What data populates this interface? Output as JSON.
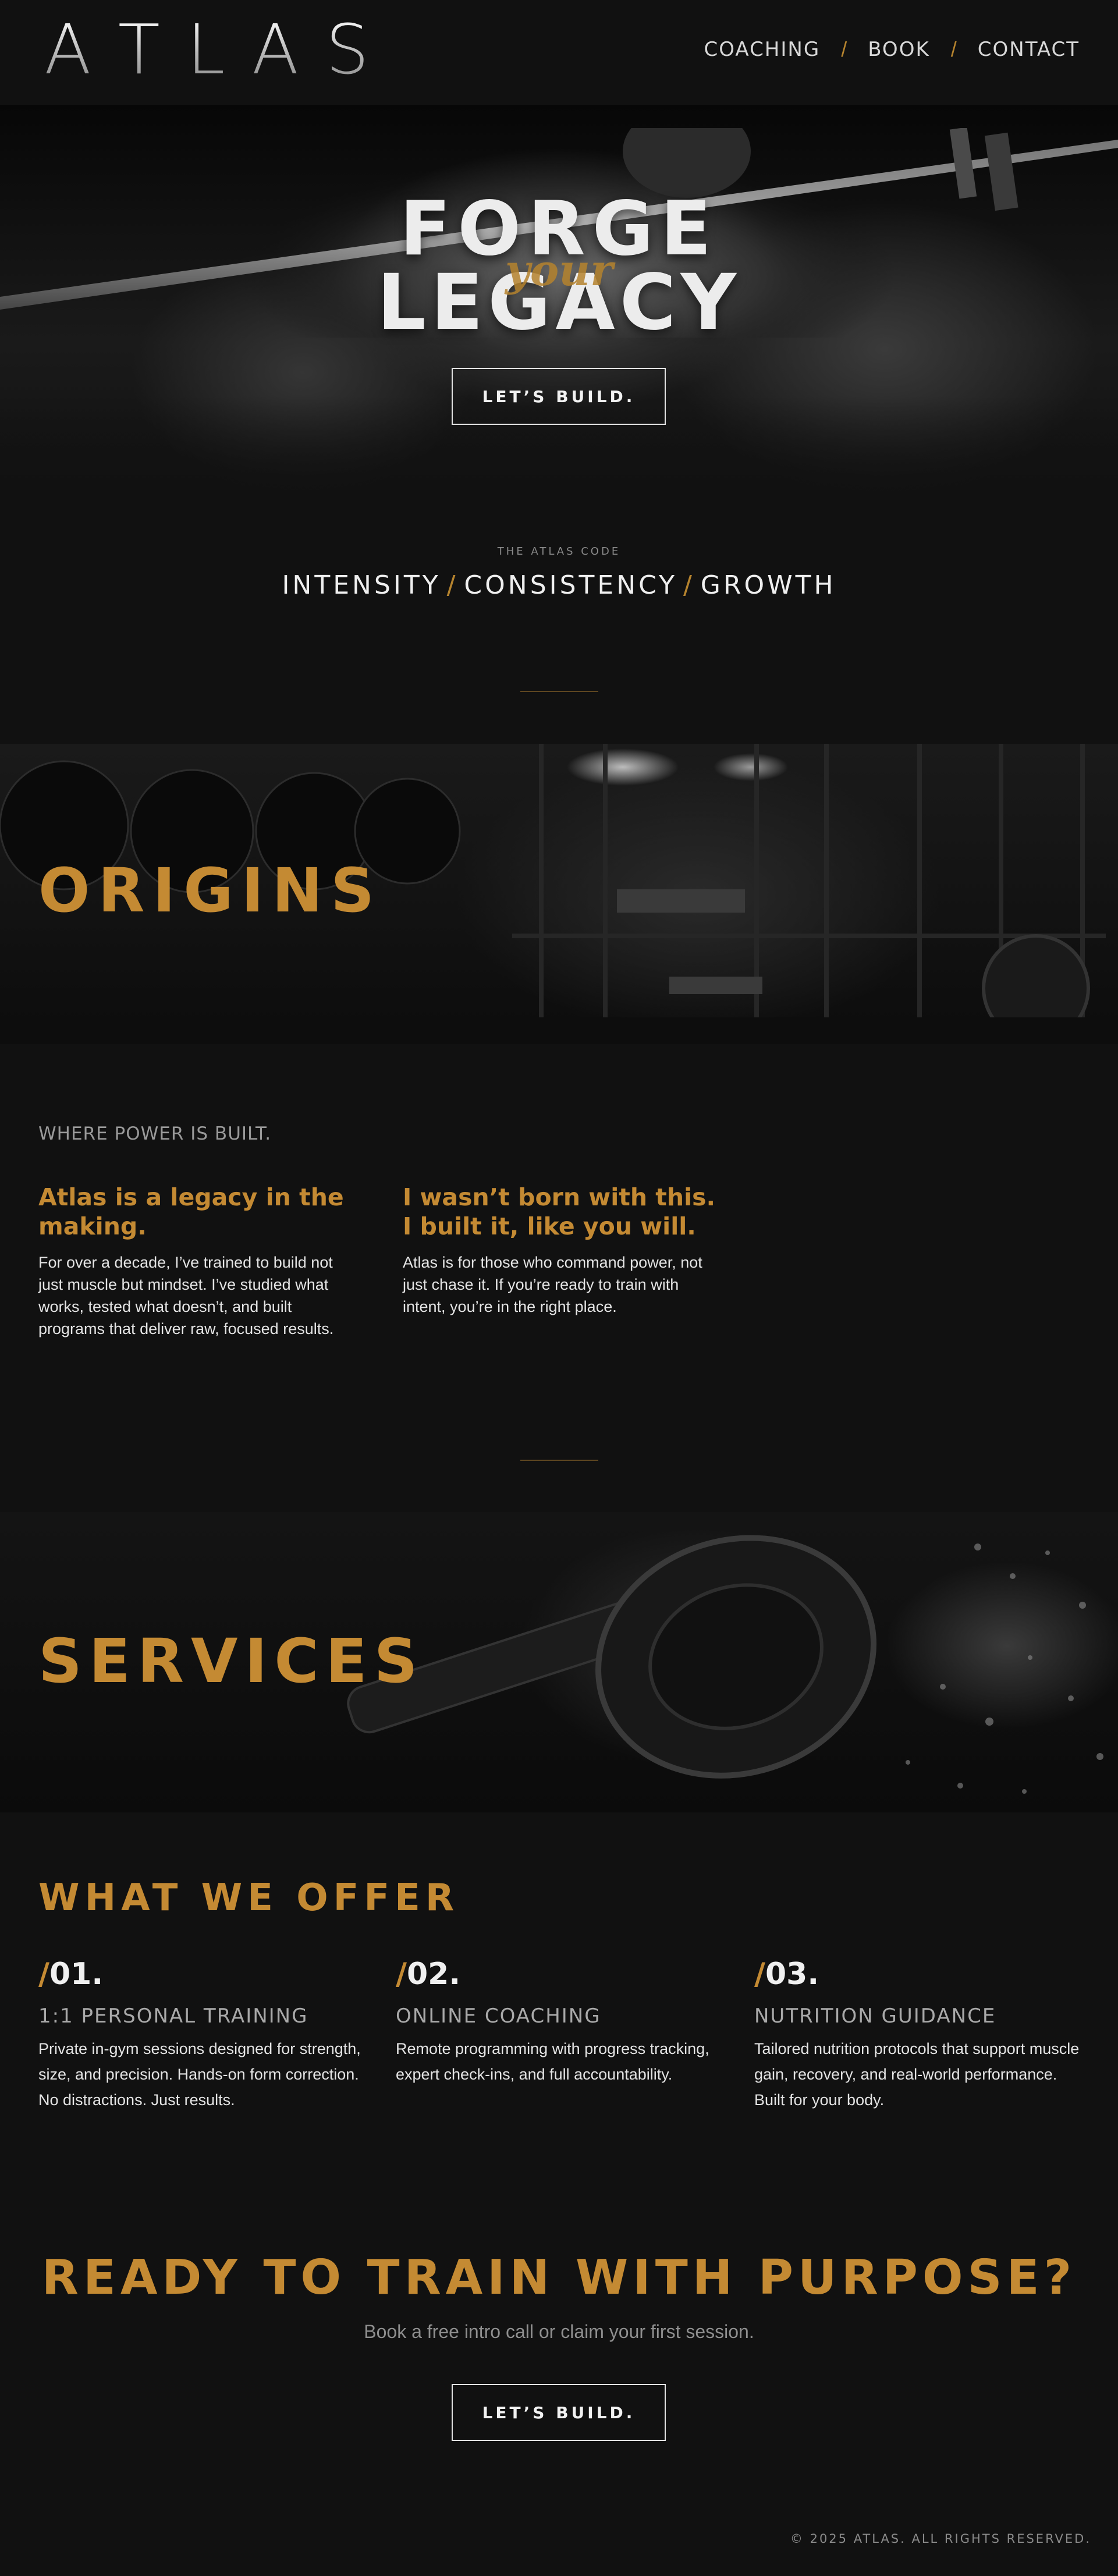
{
  "header": {
    "logo_letters": [
      "A",
      "T",
      "L",
      "A",
      "S"
    ],
    "nav": [
      "COACHING",
      "BOOK",
      "CONTACT"
    ],
    "nav_separator": "/"
  },
  "hero": {
    "line1": "FORGE",
    "script": "your",
    "line2": "LEGACY",
    "cta_label": "LET’S BUILD."
  },
  "code": {
    "eyebrow": "THE ATLAS CODE",
    "values": [
      "INTENSITY",
      "CONSISTENCY",
      "GROWTH"
    ],
    "separator": "/"
  },
  "origins": {
    "title": "ORIGINS",
    "eyebrow": "WHERE POWER IS BUILT.",
    "columns": [
      {
        "heading": "Atlas is a legacy in the making.",
        "body": "For over a decade, I’ve trained to build not just muscle but mindset. I’ve studied what works, tested what doesn’t, and built programs that deliver raw, focused results."
      },
      {
        "heading": "I wasn’t born with this. I built it, like you will.",
        "body": "Atlas is for those who command power, not just chase it. If you’re ready to train with intent, you’re in the right place."
      }
    ]
  },
  "services": {
    "title": "SERVICES",
    "offer_title": "WHAT WE OFFER",
    "items": [
      {
        "slash": "/",
        "number": "01.",
        "name": "1:1 PERSONAL TRAINING",
        "desc": "Private in-gym sessions designed for strength, size, and precision. Hands-on form correction. No distractions. Just results."
      },
      {
        "slash": "/",
        "number": "02.",
        "name": "ONLINE COACHING",
        "desc": "Remote programming with progress tracking, expert check-ins, and full accountability."
      },
      {
        "slash": "/",
        "number": "03.",
        "name": "NUTRITION GUIDANCE",
        "desc": "Tailored nutrition protocols that support muscle gain, recovery, and real-world performance. Built for your body."
      }
    ]
  },
  "cta": {
    "title": "READY TO TRAIN WITH PURPOSE?",
    "subtitle": "Book a free intro call or claim your first session.",
    "button": "LET’S BUILD."
  },
  "footer": {
    "copyright": "© 2025 ATLAS. ALL RIGHTS RESERVED."
  },
  "colors": {
    "background": "#111111",
    "accent_gold": "#c48a33",
    "text_light": "#e6e6e6",
    "text_muted": "#9a9a9a"
  }
}
